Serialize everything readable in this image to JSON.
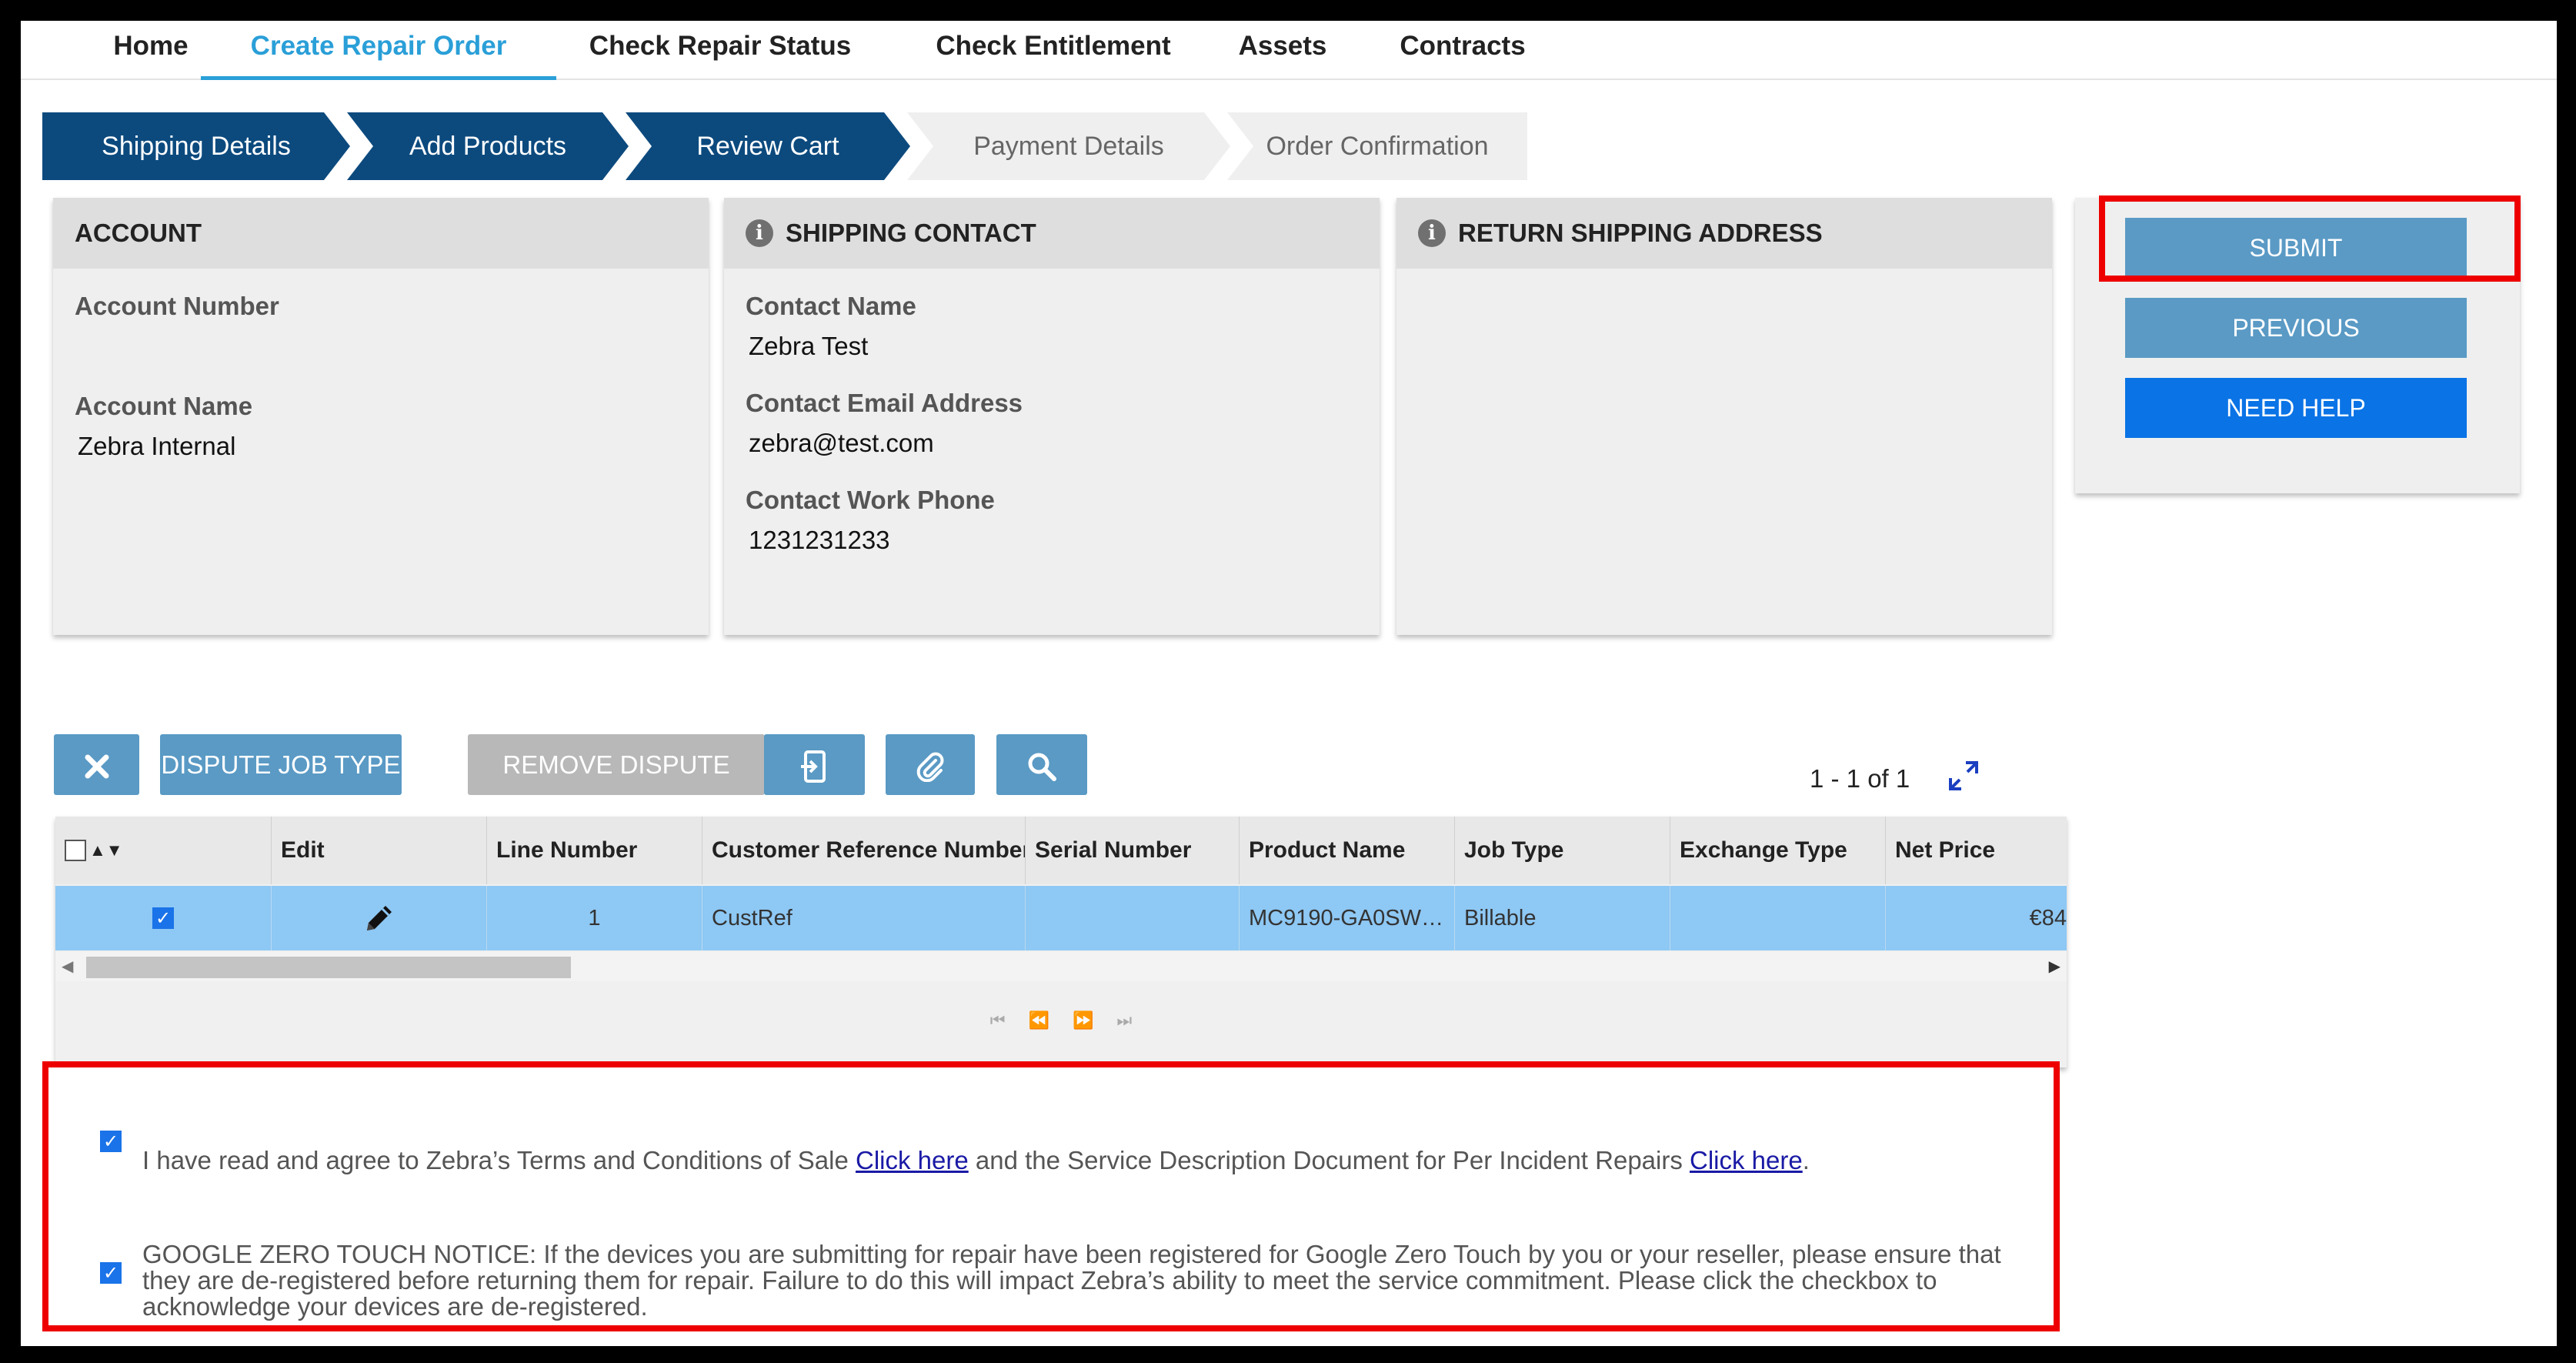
{
  "nav": {
    "items": [
      {
        "label": "Home",
        "active": false
      },
      {
        "label": "Create Repair Order",
        "active": true
      },
      {
        "label": "Check Repair Status",
        "active": false
      },
      {
        "label": "Check Entitlement",
        "active": false
      },
      {
        "label": "Assets",
        "active": false
      },
      {
        "label": "Contracts",
        "active": false
      }
    ]
  },
  "steps": [
    {
      "label": "Shipping Details",
      "state": "done"
    },
    {
      "label": "Add Products",
      "state": "done"
    },
    {
      "label": "Review Cart",
      "state": "done"
    },
    {
      "label": "Payment Details",
      "state": "todo"
    },
    {
      "label": "Order Confirmation",
      "state": "todo"
    }
  ],
  "account": {
    "title": "ACCOUNT",
    "number_label": "Account Number",
    "number_value": "",
    "name_label": "Account Name",
    "name_value": "Zebra Internal"
  },
  "shipping_contact": {
    "title": "SHIPPING CONTACT",
    "info_icon": "i",
    "name_label": "Contact Name",
    "name_value": "Zebra Test",
    "email_label": "Contact Email Address",
    "email_value": "zebra@test.com",
    "phone_label": "Contact Work Phone",
    "phone_value": "1231231233"
  },
  "return_address": {
    "title": "RETURN SHIPPING ADDRESS",
    "info_icon": "i"
  },
  "actions": {
    "submit": "SUBMIT",
    "previous": "PREVIOUS",
    "need_help": "NEED HELP",
    "colors": {
      "submit": "#5a9ac5",
      "previous": "#5a9ac5",
      "need_help": "#0a73e6"
    }
  },
  "toolbar": {
    "dispute_job_type": "DISPUTE JOB TYPE",
    "remove_dispute": "REMOVE DISPUTE",
    "icons": [
      "close-icon",
      "device-export-icon",
      "attachment-icon",
      "search-icon"
    ],
    "pager": "1 - 1 of 1"
  },
  "table": {
    "columns": [
      "Edit",
      "Line Number",
      "Customer Reference Number",
      "Serial Number",
      "Product Name",
      "Job Type",
      "Exchange Type",
      "Net Price"
    ],
    "rows": [
      {
        "selected": true,
        "line_number": "1",
        "customer_ref": "CustRef",
        "serial_number": "",
        "product_name": "MC9190-GA0SW…",
        "job_type": "Billable",
        "exchange_type": "",
        "net_price": "€84"
      }
    ]
  },
  "agreement": {
    "terms_checked": true,
    "terms_text_1": "I have read and agree to Zebra’s Terms and Conditions of Sale ",
    "terms_link_1": "Click here",
    "terms_text_2": " and the Service Description Document for Per Incident Repairs ",
    "terms_link_2": "Click here",
    "terms_text_3": ".",
    "google_checked": true,
    "google_text": "GOOGLE ZERO TOUCH NOTICE: If the devices you are submitting for repair have been registered for Google Zero Touch by you or your reseller, please ensure that they are de-registered before returning them for repair. Failure to do this will impact Zebra’s ability to meet the service commitment. Please click the checkbox to acknowledge your devices are de-registered."
  },
  "colors": {
    "accent": "#2a9fd8",
    "step_done": "#0c4a7e",
    "row_selected": "#8ec8f4",
    "highlight": "#ee0000"
  }
}
